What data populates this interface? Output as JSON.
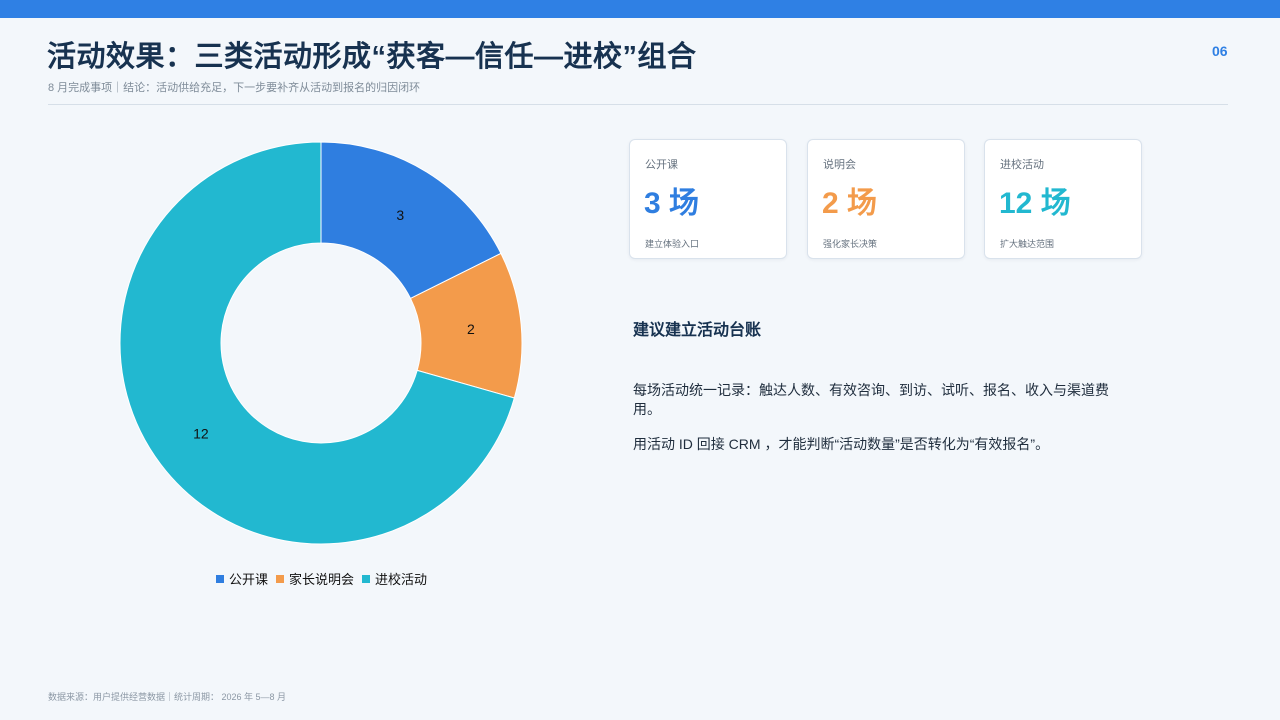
{
  "header": {
    "title": "活动效果：三类活动形成“获客—信任—进校”组合",
    "subtitle": "8 月完成事项｜结论：活动供给充足，下一步要补齐从活动到报名的归因闭环",
    "page_number": "06"
  },
  "colors": {
    "accent": "#2f80e4",
    "open_class": "#2f7ee0",
    "parent_meeting": "#f39b4b",
    "campus_event": "#22b8d0"
  },
  "chart_data": {
    "type": "pie",
    "donut": true,
    "categories": [
      "公开课",
      "家长说明会",
      "进校活动"
    ],
    "values": [
      3,
      2,
      12
    ],
    "colors": [
      "#2f7ee0",
      "#f39b4b",
      "#22b8d0"
    ],
    "data_labels": [
      "3",
      "2",
      "12"
    ],
    "legend_position": "bottom",
    "start_angle": "top, clockwise"
  },
  "cards": [
    {
      "label": "公开课",
      "value": "3 场",
      "note": "建立体验入口",
      "color": "#2f7ee0"
    },
    {
      "label": "说明会",
      "value": "2 场",
      "note": "强化家长决策",
      "color": "#f39b4b"
    },
    {
      "label": "进校活动",
      "value": "12 场",
      "note": "扩大触达范围",
      "color": "#22b8d0"
    }
  ],
  "advice": {
    "title": "建议建立活动台账",
    "paragraph1": "每场活动统一记录：触达人数、有效咨询、到访、试听、报名、收入与渠道费用。",
    "paragraph2": "用活动 ID 回接 CRM ，才能判断“活动数量”是否转化为“有效报名”。"
  },
  "footer": {
    "source": "数据来源：用户提供经营数据｜统计周期： 2026 年 5—8 月"
  }
}
